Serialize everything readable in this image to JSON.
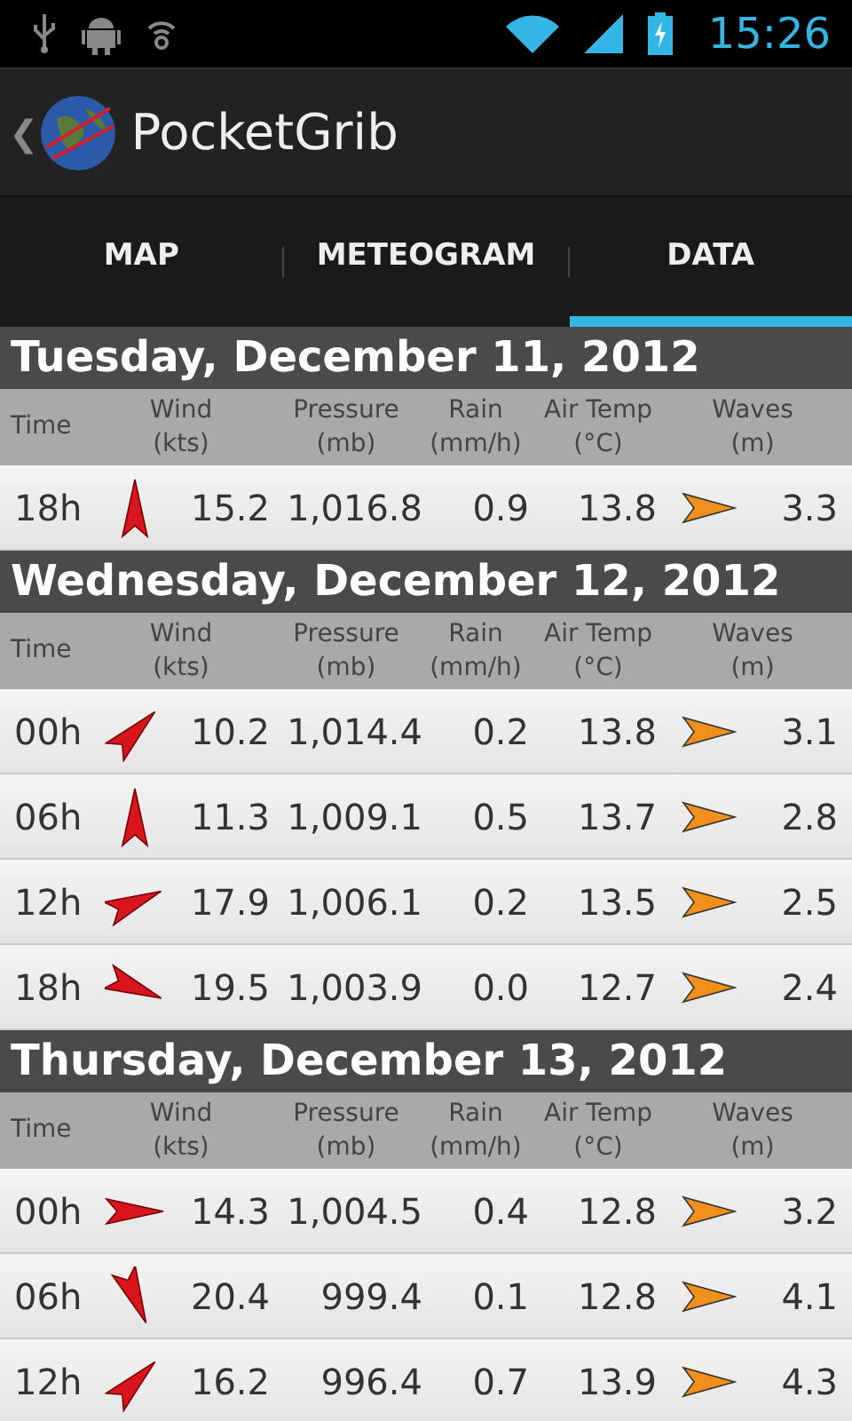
{
  "status_bar": {
    "time": "15:26"
  },
  "action_bar": {
    "back": "❮",
    "title": "PocketGrib"
  },
  "tabs": [
    {
      "label": "MAP",
      "selected": false
    },
    {
      "label": "METEOGRAM",
      "selected": false
    },
    {
      "label": "DATA",
      "selected": true
    }
  ],
  "days": [
    {
      "title": "Tuesday, December 11, 2012",
      "columns": [
        {
          "label": "Time"
        },
        {
          "label": "Wind\n(kts)"
        },
        {
          "label": "Pressure\n(mb)"
        },
        {
          "label": "Rain\n(mm/h)"
        },
        {
          "label": "Air Temp\n(°C)"
        },
        {
          "label": "Waves\n(m)"
        }
      ],
      "rows": [
        {
          "time": "18h",
          "wind_arrow": {
            "kind": "n"
          },
          "wind": "15.2",
          "pressure": "1,016.8",
          "rain": "0.9",
          "temp": "13.8",
          "wave_arrow": {
            "kind": "e"
          },
          "waves": "3.3"
        }
      ]
    },
    {
      "title": "Wednesday, December 12, 2012",
      "columns": [
        {
          "label": "Time"
        },
        {
          "label": "Wind\n(kts)"
        },
        {
          "label": "Pressure\n(mb)"
        },
        {
          "label": "Rain\n(mm/h)"
        },
        {
          "label": "Air Temp\n(°C)"
        },
        {
          "label": "Waves\n(m)"
        }
      ],
      "rows": [
        {
          "time": "00h",
          "wind_arrow": {
            "kind": "ne"
          },
          "wind": "10.2",
          "pressure": "1,014.4",
          "rain": "0.2",
          "temp": "13.8",
          "wave_arrow": {
            "kind": "e"
          },
          "waves": "3.1"
        },
        {
          "time": "06h",
          "wind_arrow": {
            "kind": "n"
          },
          "wind": "11.3",
          "pressure": "1,009.1",
          "rain": "0.5",
          "temp": "13.7",
          "wave_arrow": {
            "kind": "e"
          },
          "waves": "2.8"
        },
        {
          "time": "12h",
          "wind_arrow": {
            "kind": "ene"
          },
          "wind": "17.9",
          "pressure": "1,006.1",
          "rain": "0.2",
          "temp": "13.5",
          "wave_arrow": {
            "kind": "e"
          },
          "waves": "2.5"
        },
        {
          "time": "18h",
          "wind_arrow": {
            "kind": "ese"
          },
          "wind": "19.5",
          "pressure": "1,003.9",
          "rain": "0.0",
          "temp": "12.7",
          "wave_arrow": {
            "kind": "e"
          },
          "waves": "2.4"
        }
      ]
    },
    {
      "title": "Thursday, December 13, 2012",
      "columns": [
        {
          "label": "Time"
        },
        {
          "label": "Wind\n(kts)"
        },
        {
          "label": "Pressure\n(mb)"
        },
        {
          "label": "Rain\n(mm/h)"
        },
        {
          "label": "Air Temp\n(°C)"
        },
        {
          "label": "Waves\n(m)"
        }
      ],
      "rows": [
        {
          "time": "00h",
          "wind_arrow": {
            "kind": "e"
          },
          "wind": "14.3",
          "pressure": "1,004.5",
          "rain": "0.4",
          "temp": "12.8",
          "wave_arrow": {
            "kind": "e"
          },
          "waves": "3.2"
        },
        {
          "time": "06h",
          "wind_arrow": {
            "kind": "sse"
          },
          "wind": "20.4",
          "pressure": "999.4",
          "rain": "0.1",
          "temp": "12.8",
          "wave_arrow": {
            "kind": "e"
          },
          "waves": "4.1"
        },
        {
          "time": "12h",
          "wind_arrow": {
            "kind": "ne"
          },
          "wind": "16.2",
          "pressure": "996.4",
          "rain": "0.7",
          "temp": "13.9",
          "wave_arrow": {
            "kind": "e"
          },
          "waves": "4.3"
        }
      ]
    }
  ]
}
